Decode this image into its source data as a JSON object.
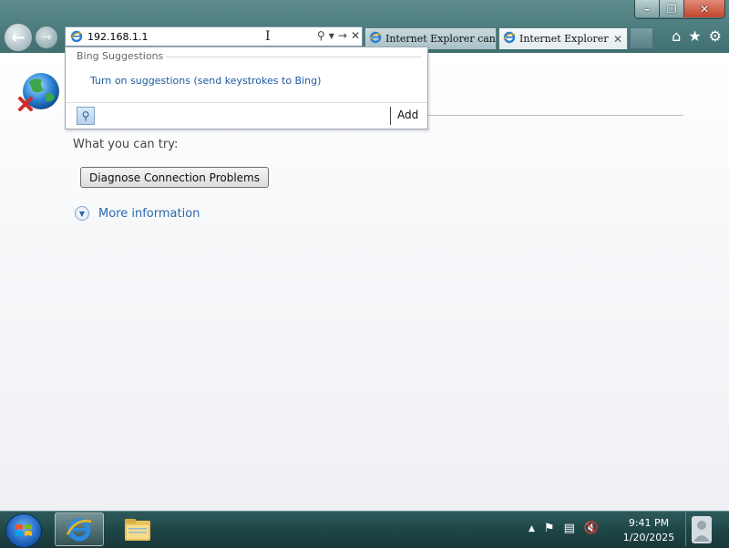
{
  "window": {
    "minimize_label": "–",
    "restore_label": "❐",
    "close_label": "✕"
  },
  "nav": {
    "back_icon": "back-arrow-icon",
    "forward_icon": "forward-arrow-icon"
  },
  "address": {
    "value": "192.168.1.1"
  },
  "tabs": [
    {
      "label": "Internet Explorer can..."
    },
    {
      "label": "Internet Explorer ..."
    }
  ],
  "suggestions": {
    "header": "Bing Suggestions",
    "link": "Turn on suggestions (send keystrokes to Bing)",
    "add_label": "Add"
  },
  "content": {
    "try_label": "What you can try:",
    "diagnose_button": "Diagnose Connection Problems",
    "more_info": "More information"
  },
  "taskbar": {
    "time": "9:41 PM",
    "date": "1/20/2025"
  },
  "colors": {
    "chrome": "#4f7f80",
    "link": "#2a6ab0",
    "taskbar": "#1f4647"
  }
}
